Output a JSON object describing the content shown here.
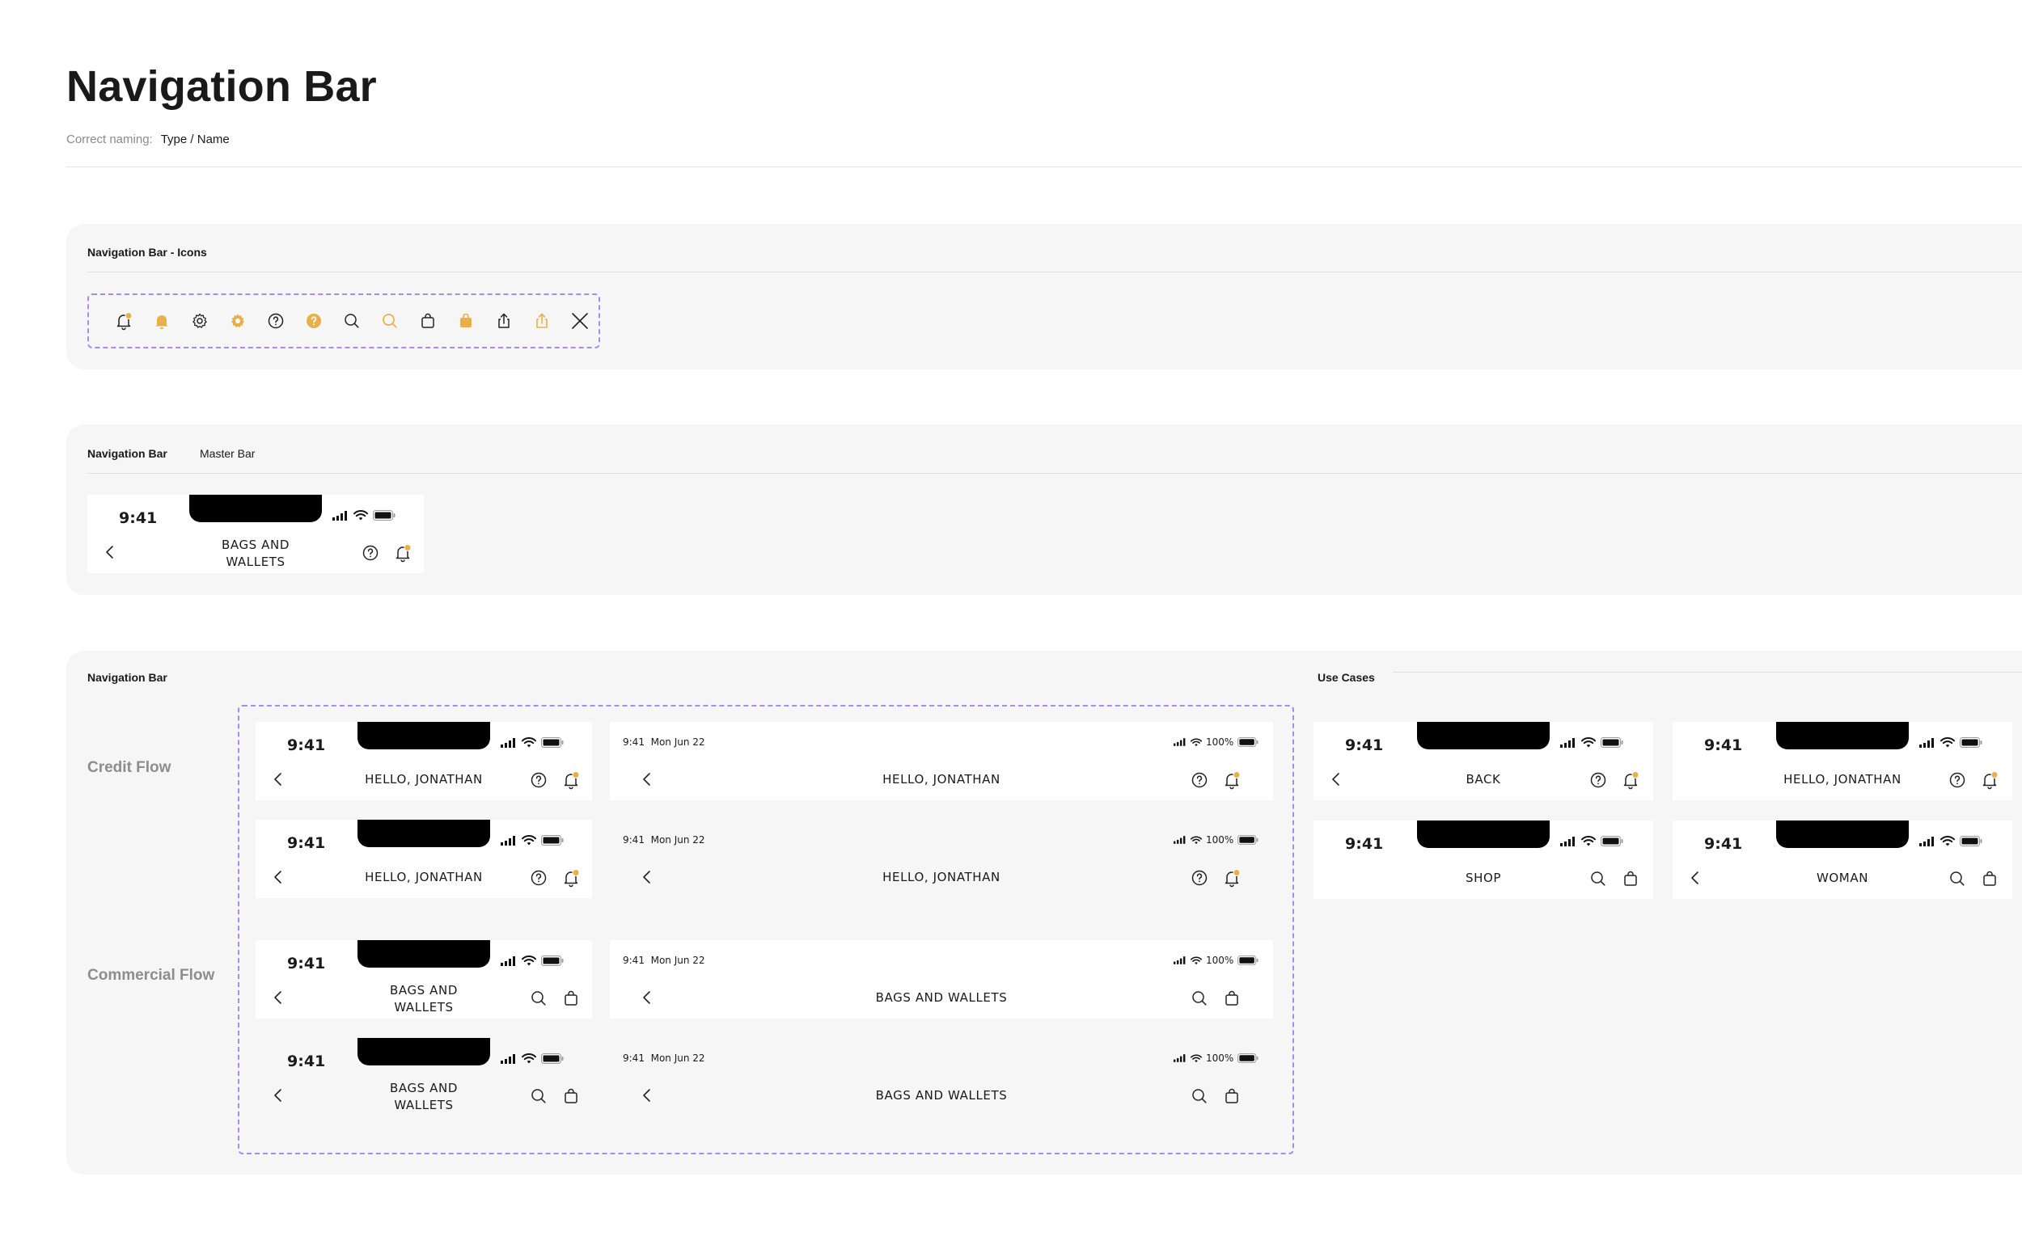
{
  "page": {
    "title": "Navigation Bar",
    "naming_label": "Correct naming:",
    "naming_value": "Type / Name"
  },
  "colors": {
    "accent": "#E8B04A",
    "frame": "#A98AF5",
    "panel": "#F6F6F6"
  },
  "icons_panel": {
    "heading": "Navigation Bar - Icons",
    "icons": [
      "bell-badge-icon",
      "bell-filled-icon",
      "gear-outline-icon",
      "gear-filled-icon",
      "help-outline-icon",
      "help-filled-icon",
      "search-outline-icon",
      "search-accent-icon",
      "bag-outline-icon",
      "bag-filled-icon",
      "share-outline-icon",
      "share-accent-icon",
      "close-icon"
    ]
  },
  "master_panel": {
    "heading": "Navigation Bar",
    "sub": "Master Bar",
    "bar": {
      "time": "9:41",
      "title_line1": "BAGS AND",
      "title_line2": "WALLETS"
    }
  },
  "variants_panel": {
    "heading": "Navigation Bar",
    "use_cases_heading": "Use Cases",
    "credit_flow_label": "Credit Flow",
    "commercial_flow_label": "Commercial Flow",
    "credit_rows": [
      {
        "time": "9:41",
        "title": "HELLO, JONATHAN",
        "wide_time": "9:41",
        "wide_date": "Mon Jun 22",
        "wide_pct": "100%",
        "wide_title": "HELLO, JONATHAN"
      },
      {
        "time": "9:41",
        "title": "HELLO, JONATHAN",
        "wide_time": "9:41",
        "wide_date": "Mon Jun 22",
        "wide_pct": "100%",
        "wide_title": "HELLO, JONATHAN"
      }
    ],
    "commercial_rows": [
      {
        "time": "9:41",
        "title_line1": "BAGS AND",
        "title_line2": "WALLETS",
        "wide_time": "9:41",
        "wide_date": "Mon Jun 22",
        "wide_pct": "100%",
        "wide_title": "BAGS AND WALLETS"
      },
      {
        "time": "9:41",
        "title_line1": "BAGS AND",
        "title_line2": "WALLETS",
        "wide_time": "9:41",
        "wide_date": "Mon Jun 22",
        "wide_pct": "100%",
        "wide_title": "BAGS AND WALLETS"
      }
    ],
    "use_cases": [
      {
        "time": "9:41",
        "title": "BACK"
      },
      {
        "time": "9:41",
        "title": "HELLO, JONATHAN"
      },
      {
        "time": "9:41",
        "title": "SHOP"
      },
      {
        "time": "9:41",
        "title": "WOMAN"
      }
    ]
  }
}
